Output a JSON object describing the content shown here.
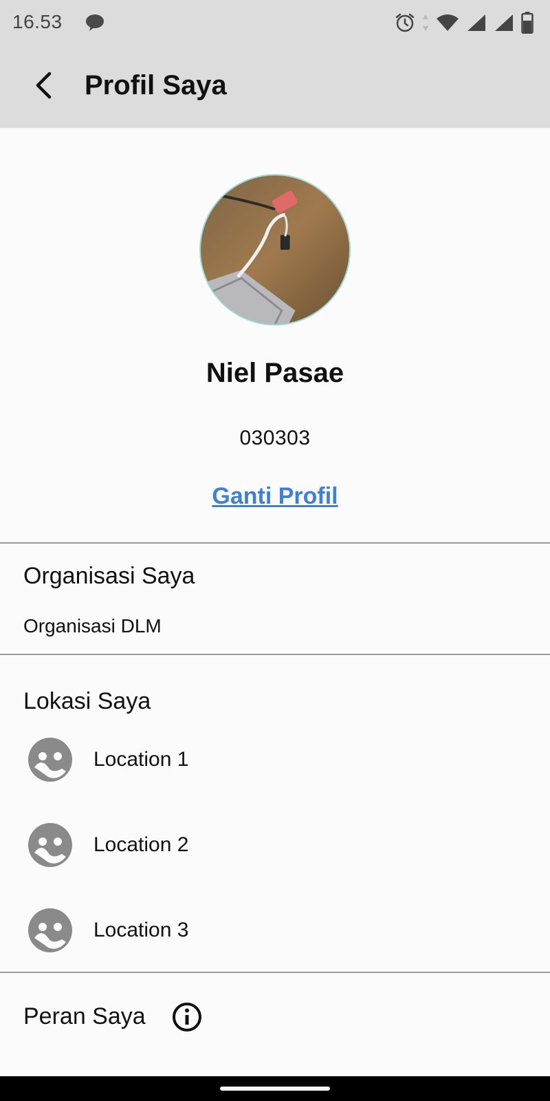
{
  "status_bar": {
    "time": "16.53",
    "icons": [
      "chat-bubble-icon",
      "alarm-icon",
      "data-arrows-icon",
      "wifi-icon",
      "signal-icon",
      "signal-icon",
      "battery-icon"
    ]
  },
  "app_bar": {
    "back_icon": "arrow-back-icon",
    "title": "Profil Saya"
  },
  "profile": {
    "avatar": "profile-photo",
    "name": "Niel Pasae",
    "id": "030303",
    "change_link": "Ganti Profil"
  },
  "organization": {
    "title": "Organisasi Saya",
    "value": "Organisasi DLM"
  },
  "locations": {
    "title": "Lokasi Saya",
    "items": [
      {
        "label": "Location 1",
        "icon": "placeholder-avatar-icon"
      },
      {
        "label": "Location 2",
        "icon": "placeholder-avatar-icon"
      },
      {
        "label": "Location 3",
        "icon": "placeholder-avatar-icon"
      }
    ]
  },
  "roles": {
    "title": "Peran Saya",
    "info_icon": "info-icon"
  },
  "colors": {
    "app_bar_bg": "#dcdcdc",
    "background": "#fbfbfb",
    "link": "#3f7fd6",
    "avatar_ring": "#9cd9d4",
    "icon_gray": "#8a8a8a"
  }
}
